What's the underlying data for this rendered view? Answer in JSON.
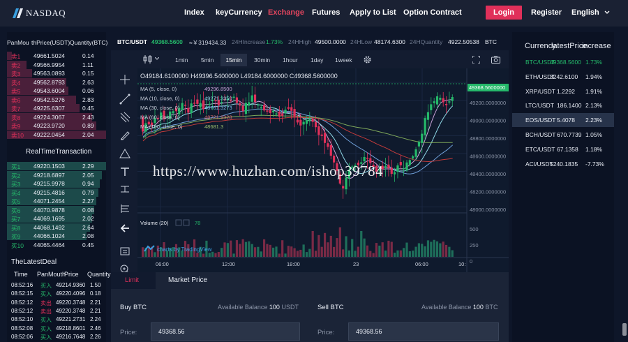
{
  "header": {
    "brand": "NASDAQ",
    "nav": [
      {
        "label": "Index"
      },
      {
        "label": "keyCurrency"
      },
      {
        "label": "Exchange"
      },
      {
        "label": "Futures"
      },
      {
        "label": "Apply to List"
      },
      {
        "label": "Option Contract"
      }
    ],
    "login": "Login",
    "register": "Register",
    "language": "English"
  },
  "orderbook": {
    "headers": [
      "PanMou",
      "thPrice(USDT)",
      "Quantity(BTC)"
    ],
    "sells": [
      {
        "label": "卖1",
        "price": "49661.5024",
        "qty": "0.14",
        "depth": 0.05
      },
      {
        "label": "卖2",
        "price": "49566.9954",
        "qty": "1.11",
        "depth": 0.2
      },
      {
        "label": "卖3",
        "price": "49563.0893",
        "qty": "0.15",
        "depth": 0.25
      },
      {
        "label": "卖4",
        "price": "49562.8793",
        "qty": "2.63",
        "depth": 0.6
      },
      {
        "label": "卖5",
        "price": "49543.6004",
        "qty": "0.06",
        "depth": 0.62
      },
      {
        "label": "卖6",
        "price": "49542.5276",
        "qty": "2.83",
        "depth": 0.7
      },
      {
        "label": "卖7",
        "price": "49225.6307",
        "qty": "0.45",
        "depth": 0.73
      },
      {
        "label": "卖8",
        "price": "49224.3067",
        "qty": "2.43",
        "depth": 0.86
      },
      {
        "label": "卖9",
        "price": "49223.9720",
        "qty": "0.89",
        "depth": 0.9
      },
      {
        "label": "卖10",
        "price": "49222.0454",
        "qty": "2.04",
        "depth": 1.0
      }
    ],
    "realtime_title": "RealTimeTransaction",
    "buys": [
      {
        "label": "买1",
        "price": "49220.1503",
        "qty": "2.29",
        "depth": 1.0
      },
      {
        "label": "买2",
        "price": "49218.6897",
        "qty": "2.05",
        "depth": 0.96
      },
      {
        "label": "买3",
        "price": "49215.9978",
        "qty": "0.94",
        "depth": 0.94
      },
      {
        "label": "买4",
        "price": "49215.4816",
        "qty": "0.79",
        "depth": 0.92
      },
      {
        "label": "买5",
        "price": "44071.2454",
        "qty": "2.27",
        "depth": 0.9
      },
      {
        "label": "买6",
        "price": "44070.9878",
        "qty": "0.08",
        "depth": 0.88
      },
      {
        "label": "买7",
        "price": "44069.1695",
        "qty": "2.02",
        "depth": 0.86
      },
      {
        "label": "买8",
        "price": "44068.1492",
        "qty": "2.64",
        "depth": 0.84
      },
      {
        "label": "买9",
        "price": "44066.1024",
        "qty": "2.08",
        "depth": 0.8
      },
      {
        "label": "买10",
        "price": "44065.4464",
        "qty": "0.45",
        "depth": 0.0
      }
    ]
  },
  "latest_deal": {
    "title": "TheLatestDeal",
    "headers": [
      "Time",
      "PanMouth",
      "Price",
      "Quantity"
    ],
    "rows": [
      {
        "time": "08:52:16",
        "side": "买入",
        "type": "buy",
        "price": "49214.9360",
        "qty": "1.50"
      },
      {
        "time": "08:52:15",
        "side": "买入",
        "type": "buy",
        "price": "49220.4096",
        "qty": "0.18"
      },
      {
        "time": "08:52:12",
        "side": "卖出",
        "type": "sell",
        "price": "49220.3748",
        "qty": "2.21"
      },
      {
        "time": "08:52:12",
        "side": "卖出",
        "type": "sell",
        "price": "49220.3748",
        "qty": "2.21"
      },
      {
        "time": "08:52:10",
        "side": "买入",
        "type": "buy",
        "price": "49221.2731",
        "qty": "2.24"
      },
      {
        "time": "08:52:08",
        "side": "买入",
        "type": "buy",
        "price": "49218.8601",
        "qty": "2.46"
      },
      {
        "time": "08:52:06",
        "side": "买入",
        "type": "buy",
        "price": "49216.7648",
        "qty": "2.26"
      }
    ]
  },
  "ticker": {
    "pair": "BTC/USDT",
    "price": "49368.5600",
    "approx": "≈￥319434.33",
    "increase_label": "24HIncrease",
    "increase_value": "1.73%",
    "high_label": "24HHigh",
    "high_value": "49500.0000",
    "low_label": "24HLow",
    "low_value": "48174.6300",
    "qty_label": "24HQuantity",
    "qty_value": "4922.50538",
    "qty_unit": "BTC"
  },
  "timeframes": [
    "1min",
    "5min",
    "15min",
    "30min",
    "1hour",
    "1day",
    "1week"
  ],
  "active_timeframe": "15min",
  "chart": {
    "ohlc": "O49184.6100000 H49396.5400000 L49184.6000000 C49368.5600000",
    "ma_labels": [
      "MA (5, close, 0)",
      "MA (10, close, 0)",
      "MA (30, close, 0)",
      "MA (60, close, 0)",
      "MA (100, close, 0)"
    ],
    "ma_values": [
      "49296.8500",
      "49271.3350",
      "48761.3273",
      "48721.9328",
      "48681.3"
    ],
    "last_price_tag": "49368.5600000",
    "price_ticks": [
      "49200.0000000",
      "49000.0000000",
      "48800.0000000",
      "48600.0000000",
      "48400.0000000",
      "48200.0000000",
      "48000.0000000"
    ],
    "volume_label": "Volume (20)",
    "volume_value": "78",
    "volume_ticks": [
      "500",
      "250",
      "0"
    ],
    "time_ticks": [
      "06:00",
      "12:00",
      "18:00",
      "23",
      "06:00",
      "10:"
    ],
    "credit": "charts by TradingView",
    "watermark": "https://www.huzhan.com/ishop39784"
  },
  "colors": {
    "up": "#25b86a",
    "down": "#e0305a",
    "accent": "#e0305a"
  },
  "trade": {
    "tab_limit": "Limit",
    "tab_market": "Market Price",
    "buy_title": "Buy BTC",
    "sell_title": "Sell BTC",
    "avail_label": "Available Balance",
    "buy_balance": "100",
    "buy_unit": "USDT",
    "sell_balance": "100",
    "sell_unit": "BTC",
    "price_label": "Price:",
    "buy_price": "49368.56",
    "sell_price": "49368.56"
  },
  "markets": {
    "headers": [
      "Currency",
      "latestPrice",
      "increase"
    ],
    "rows": [
      {
        "pair": "BTC/USDT",
        "price": "49368.5600",
        "change": "1.73%",
        "active": true
      },
      {
        "pair": "ETH/USDT",
        "price": "3242.6100",
        "change": "1.94%"
      },
      {
        "pair": "XRP/USDT",
        "price": "1.2292",
        "change": "1.91%"
      },
      {
        "pair": "LTC/USDT",
        "price": "186.1400",
        "change": "2.13%"
      },
      {
        "pair": "EOS/USDT",
        "price": "5.4078",
        "change": "2.23%",
        "selected": true
      },
      {
        "pair": "BCH/USDT",
        "price": "670.7739",
        "change": "1.05%"
      },
      {
        "pair": "ETC/USDT",
        "price": "67.1358",
        "change": "1.18%"
      },
      {
        "pair": "ACI/USDT",
        "price": "5240.1835",
        "change": "-7.73%"
      }
    ]
  }
}
